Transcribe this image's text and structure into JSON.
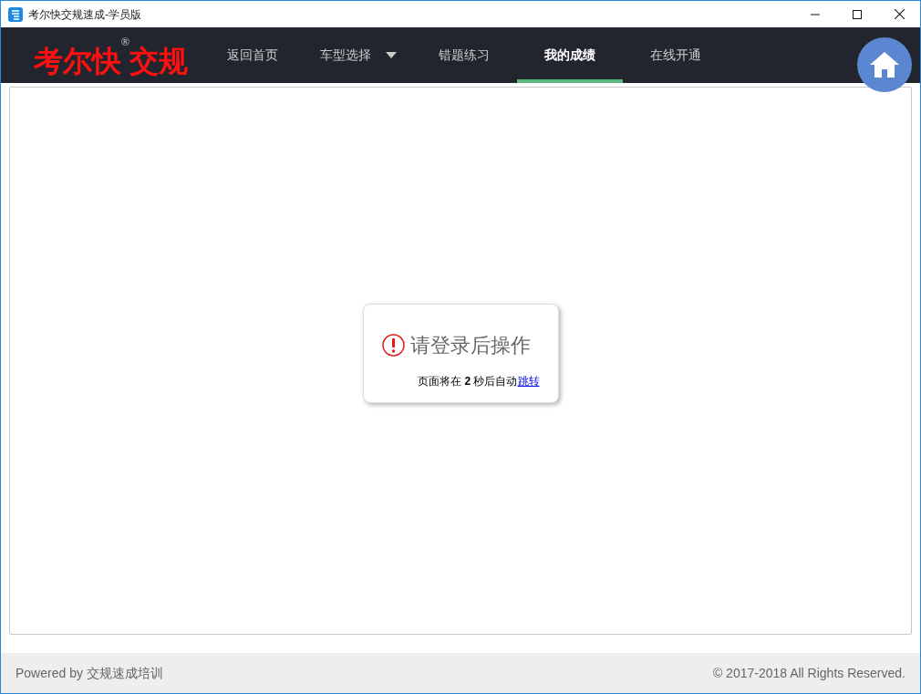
{
  "window": {
    "title": "考尔快交规速成-学员版"
  },
  "logo": {
    "name": "考尔快",
    "mark": "®",
    "suffix": "交规"
  },
  "nav": [
    {
      "label": "返回首页",
      "selected": false,
      "dropdown": false
    },
    {
      "label": "车型选择",
      "selected": false,
      "dropdown": true
    },
    {
      "label": "错题练习",
      "selected": false,
      "dropdown": false
    },
    {
      "label": "我的成绩",
      "selected": true,
      "dropdown": false
    },
    {
      "label": "在线开通",
      "selected": false,
      "dropdown": false
    }
  ],
  "dialog": {
    "title": "请登录后操作",
    "message": "页面将在 **2** 秒后自动",
    "link": "跳转"
  },
  "footer": {
    "left": "Powered by 交规速成培训",
    "right": "© 2017-2018 All Rights Reserved."
  }
}
